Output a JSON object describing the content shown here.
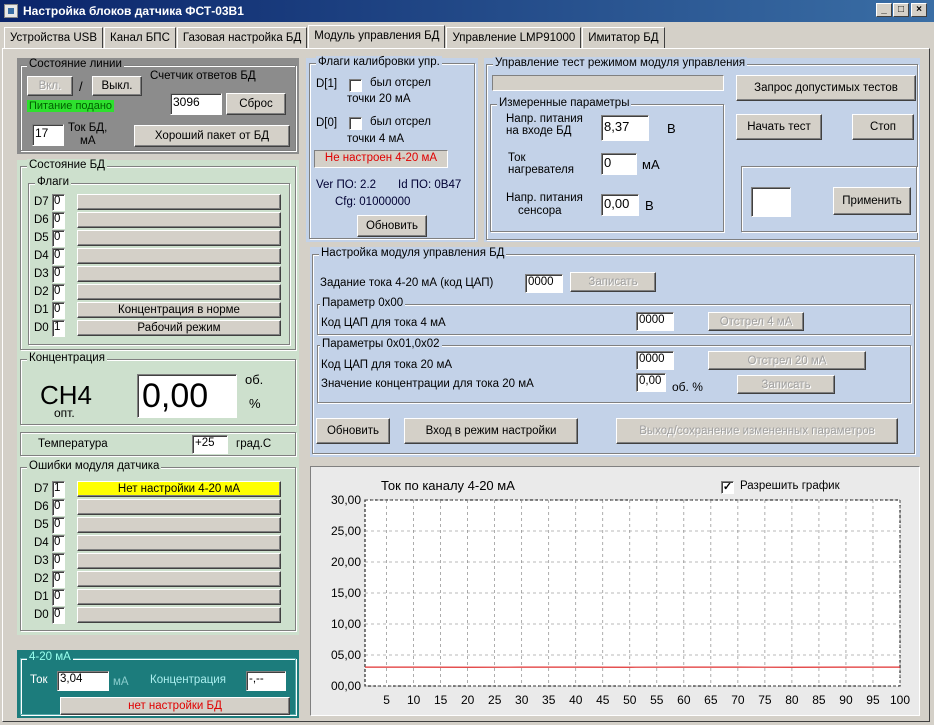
{
  "window": {
    "title": "Настройка блоков датчика ФСТ-03В1"
  },
  "tabs": [
    "Устройства USB",
    "Канал БПС",
    "Газовая настройка БД",
    "Модуль управления БД",
    "Управление LMP91000",
    "Имитатор БД"
  ],
  "line_state": {
    "title": "Состояние линии",
    "on": "Вкл.",
    "slash": "/",
    "off": "Выкл.",
    "power": "Питание подано",
    "counter_label": "Счетчик ответов БД",
    "counter_value": "3096",
    "reset": "Сброс",
    "current_value": "17",
    "current_label": "Ток БД,",
    "current_unit": "мА",
    "good_packet": "Хороший пакет от БД"
  },
  "bd_state": {
    "title": "Состояние БД",
    "flags_title": "Флаги",
    "flags": [
      {
        "name": "D7",
        "val": "0",
        "text": ""
      },
      {
        "name": "D6",
        "val": "0",
        "text": ""
      },
      {
        "name": "D5",
        "val": "0",
        "text": ""
      },
      {
        "name": "D4",
        "val": "0",
        "text": ""
      },
      {
        "name": "D3",
        "val": "0",
        "text": ""
      },
      {
        "name": "D2",
        "val": "0",
        "text": ""
      },
      {
        "name": "D1",
        "val": "0",
        "text": "Концентрация в норме"
      },
      {
        "name": "D0",
        "val": "1",
        "text": "Рабочий режим"
      }
    ]
  },
  "conc": {
    "title": "Концентрация",
    "gas": "CH4",
    "sub": "опт.",
    "value": "0,00",
    "unit1": "об.",
    "unit2": "%"
  },
  "temp": {
    "label": "Температура",
    "value": "+25",
    "unit": "град.С"
  },
  "errors": {
    "title": "Ошибки модуля датчика",
    "flags": [
      {
        "name": "D7",
        "val": "1",
        "text": "Нет настройки 4-20 мА"
      },
      {
        "name": "D6",
        "val": "0",
        "text": ""
      },
      {
        "name": "D5",
        "val": "0",
        "text": ""
      },
      {
        "name": "D4",
        "val": "0",
        "text": ""
      },
      {
        "name": "D3",
        "val": "0",
        "text": ""
      },
      {
        "name": "D2",
        "val": "0",
        "text": ""
      },
      {
        "name": "D1",
        "val": "0",
        "text": ""
      },
      {
        "name": "D0",
        "val": "0",
        "text": ""
      }
    ]
  },
  "ma": {
    "title": "4-20 мА",
    "current_label": "Ток",
    "current_value": "3,04",
    "current_unit": "мА",
    "conc_label": "Концентрация",
    "conc_value": "-,--",
    "status": "нет настройки БД"
  },
  "calib": {
    "title": "Флаги калибровки упр.",
    "d1": "D[1]",
    "d1_text1": "был отсрел",
    "d1_text2": "точки 20 мА",
    "d0": "D[0]",
    "d0_text1": "был отсрел",
    "d0_text2": "точки 4 мА",
    "status": "Не настроен 4-20 мА",
    "ver": "Ver ПО: 2.2",
    "id": "Id ПО: 0B47",
    "cfg": "Cfg: 01000000",
    "refresh": "Обновить"
  },
  "testmode": {
    "title": "Управление тест режимом модуля управления",
    "request": "Запрос допустимых тестов",
    "meas_title": "Измеренные параметры",
    "v_in_label1": "Напр. питания",
    "v_in_label2": "на входе БД",
    "v_in_value": "8,37",
    "v_in_unit": "В",
    "heater_label1": "Ток",
    "heater_label2": "нагревателя",
    "heater_value": "0",
    "heater_unit": "мА",
    "v_sens_label1": "Напр. питания",
    "v_sens_label2": "сенсора",
    "v_sens_value": "0,00",
    "v_sens_unit": "В",
    "start": "Начать тест",
    "stop": "Стоп",
    "apply_value": "",
    "apply": "Применить"
  },
  "setup": {
    "title": "Настройка модуля управления БД",
    "dac_label": "Задание тока 4-20 мА (код ЦАП)",
    "dac_value": "0000",
    "write": "Записать",
    "p0_title": "Параметр 0x00",
    "p0_label": "Код ЦАП для тока 4 мА",
    "p0_value": "0000",
    "p0_btn": "Отстрел 4 мА",
    "p12_title": "Параметры 0x01,0x02",
    "p1_label": "Код ЦАП для тока 20 мА",
    "p1_value": "0000",
    "p1_btn": "Отстрел 20 мА",
    "p2_label": "Значение концентрации для тока 20 мА",
    "p2_value": "0,00",
    "p2_unit": "об. %",
    "p2_btn": "Записать",
    "refresh": "Обновить",
    "enter": "Вход в режим настройки",
    "exit": "Выход/сохранение измененных параметров"
  },
  "chart_title": "Ток по каналу 4-20 мА",
  "chart_enable": "Разрешить график",
  "chart_data": {
    "type": "line",
    "title": "Ток по каналу 4-20 мА",
    "xlabel": "",
    "ylabel": "",
    "xlim": [
      1,
      100
    ],
    "ylim": [
      0,
      30
    ],
    "xticks": [
      "5",
      "10",
      "15",
      "20",
      "25",
      "30",
      "35",
      "40",
      "45",
      "50",
      "55",
      "60",
      "65",
      "70",
      "75",
      "80",
      "85",
      "90",
      "95",
      "100"
    ],
    "yticks": [
      "00,00",
      "05,00",
      "10,00",
      "15,00",
      "20,00",
      "25,00",
      "30,00"
    ],
    "series": [
      {
        "color": "#e03030",
        "x": [
          1,
          10,
          20,
          30,
          40,
          50,
          60,
          70,
          80,
          90,
          100
        ],
        "values": [
          3.04,
          3.04,
          3.03,
          3.04,
          3.04,
          3.03,
          3.04,
          3.04,
          3.03,
          3.04,
          3.04
        ]
      }
    ],
    "grid": true,
    "legend": "none"
  },
  "colors": {
    "title_start": "#0a246a",
    "title_end": "#3a6ea5",
    "green_panel": "#cde0cd",
    "blue_panel": "#c3d2e8",
    "teal_panel": "#1c7c7c",
    "power_green": "#2ee02e",
    "warn_red": "#e00000",
    "error_yellow": "#ffff00"
  }
}
